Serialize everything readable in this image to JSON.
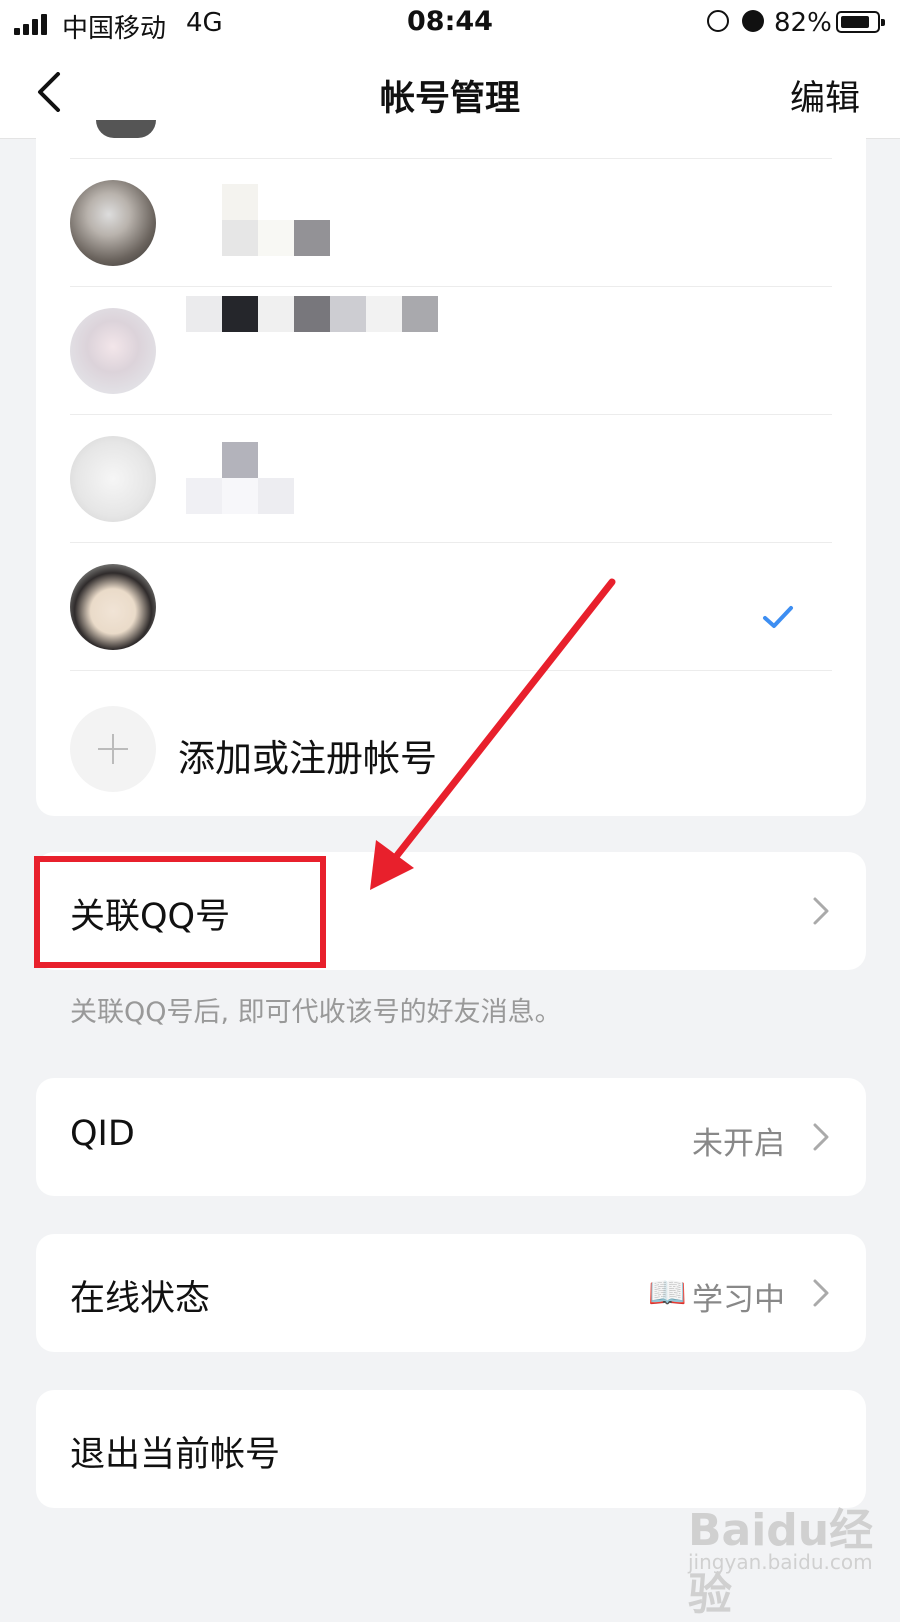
{
  "status_bar": {
    "carrier": "中国移动",
    "network": "4G",
    "time": "08:44",
    "battery_percent": "82%",
    "battery_level": 0.82,
    "icons": [
      "signal-icon",
      "orientation-lock-icon",
      "alarm-icon",
      "battery-icon"
    ]
  },
  "navbar": {
    "back_icon": "chevron-left-icon",
    "title": "帐号管理",
    "edit_label": "编辑"
  },
  "accounts": {
    "rows": [
      {
        "avatar": "cat-avatar",
        "selected": false
      },
      {
        "avatar": "anime-girl-avatar",
        "selected": false
      },
      {
        "avatar": "sketch-avatar",
        "selected": false
      },
      {
        "avatar": "anime-boy-avatar",
        "selected": true
      }
    ],
    "add_label": "添加或注册帐号"
  },
  "link_qq": {
    "label": "关联QQ号",
    "hint": "关联QQ号后, 即可代收该号的好友消息。"
  },
  "qid": {
    "label": "QID",
    "value": "未开启"
  },
  "online_status": {
    "label": "在线状态",
    "icon": "📖",
    "value": "学习中"
  },
  "logout": {
    "label": "退出当前帐号"
  },
  "watermark": {
    "text": "Baidu经验",
    "sub": "jingyan.baidu.com"
  },
  "colors": {
    "accent": "#3d8ef2",
    "annotation_red": "#e8202c",
    "background": "#f2f3f5"
  }
}
